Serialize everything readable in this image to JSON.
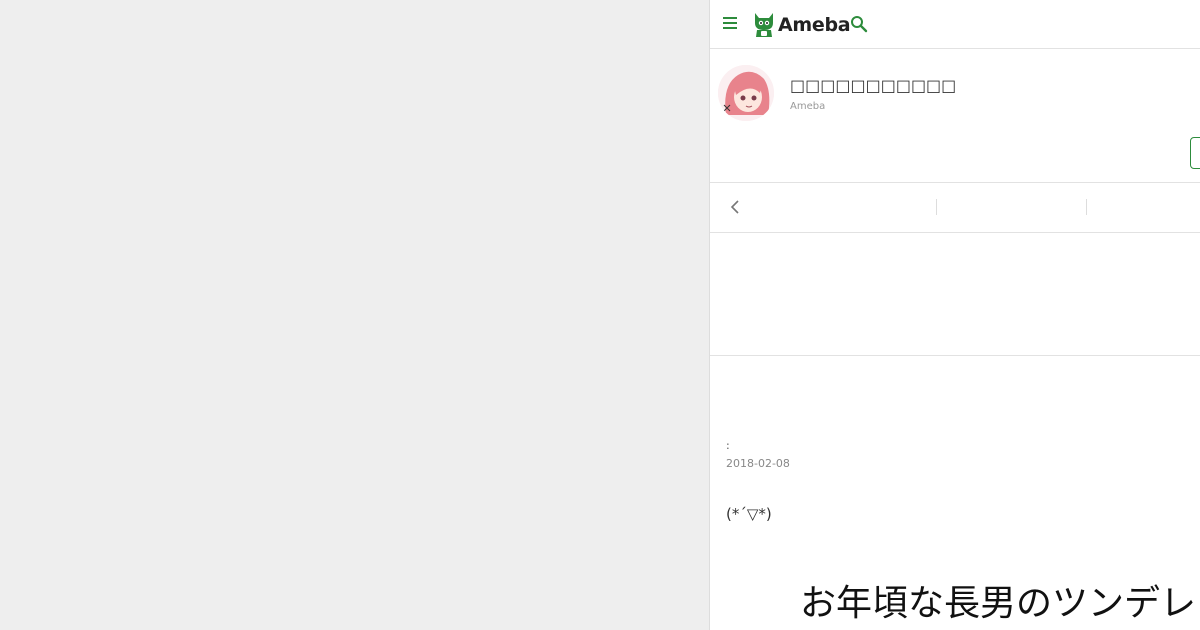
{
  "header": {
    "logo_text": "Ameba",
    "menu_icon": "hamburger-menu-icon",
    "search_icon": "search-icon",
    "brand_color": "#2d8c3c"
  },
  "profile": {
    "blog_title": "□□□□□□□□□□□",
    "sub_label": "Ameba"
  },
  "entry": {
    "theme": ":",
    "date": "2018-02-08",
    "text": "(*´▽*)",
    "heading": "お年頃な長男のツンデレ"
  }
}
